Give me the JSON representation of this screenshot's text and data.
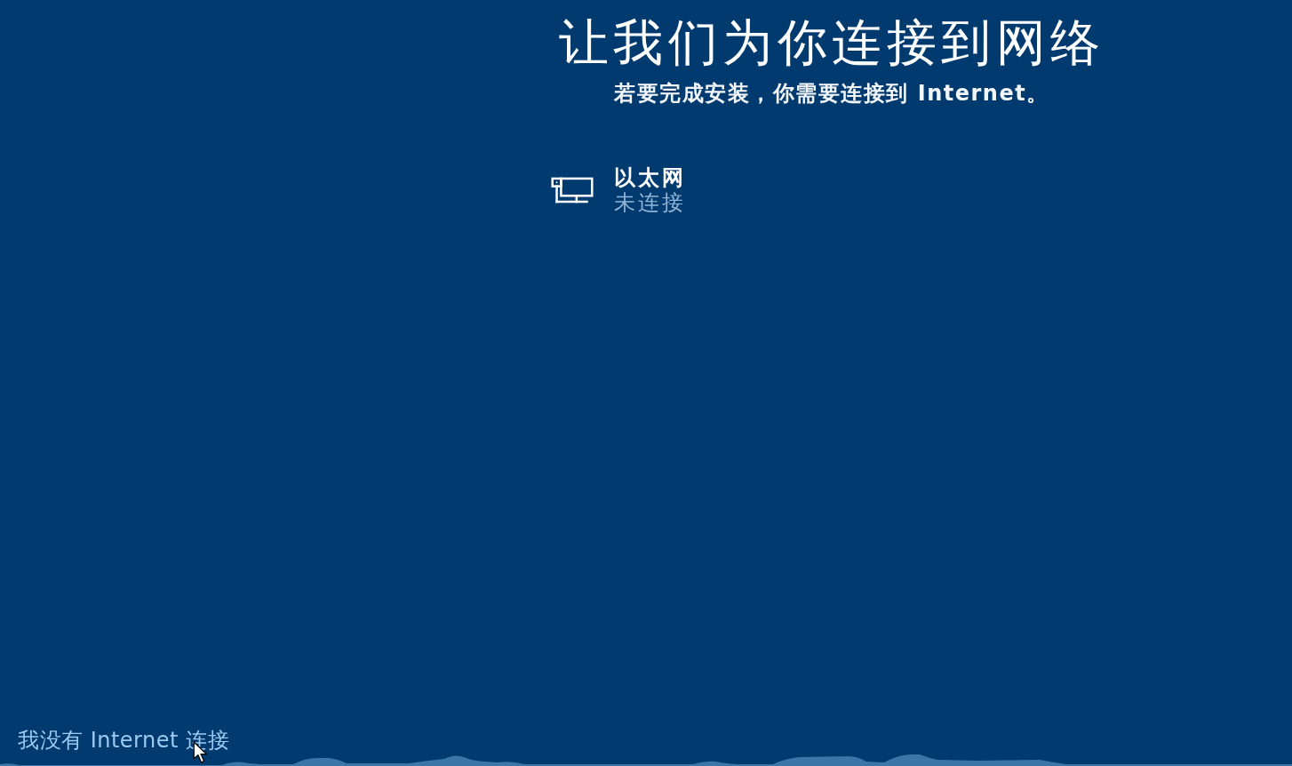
{
  "header": {
    "title": "让我们为你连接到网络",
    "subtitle": "若要完成安装，你需要连接到 Internet。"
  },
  "networks": [
    {
      "kind": "ethernet",
      "name": "以太网",
      "status": "未连接"
    }
  ],
  "skip_link": {
    "label": "我没有 Internet 连接"
  }
}
